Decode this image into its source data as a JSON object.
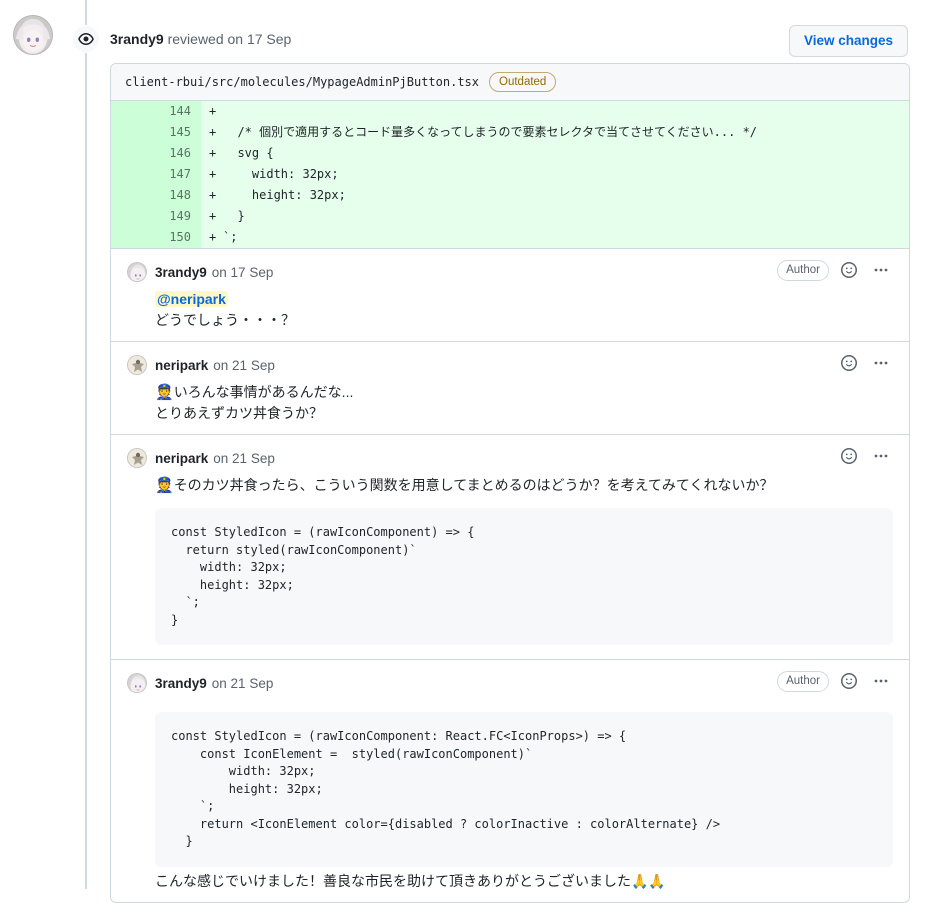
{
  "review": {
    "author": "3randy9",
    "action_text": "reviewed on 17 Sep",
    "view_changes_label": "View changes",
    "eye_icon": "eye-icon"
  },
  "diff": {
    "file_path": "client-rbui/src/molecules/MypageAdminPjButton.tsx",
    "status_badge": "Outdated",
    "lines": [
      {
        "number": "144",
        "marker": "+",
        "code": ""
      },
      {
        "number": "145",
        "marker": "+",
        "code": "  /* 個別で適用するとコード量多くなってしまうので要素セレクタで当てさせてください... */"
      },
      {
        "number": "146",
        "marker": "+",
        "code": "  svg {"
      },
      {
        "number": "147",
        "marker": "+",
        "code": "    width: 32px;"
      },
      {
        "number": "148",
        "marker": "+",
        "code": "    height: 32px;"
      },
      {
        "number": "149",
        "marker": "+",
        "code": "  }"
      },
      {
        "number": "150",
        "marker": "+",
        "code": "`;"
      }
    ]
  },
  "comments": [
    {
      "user": "3randy9",
      "date": "on 17 Sep",
      "author_badge": "Author",
      "mention": "@neripark",
      "line1": "どうでしょう・・・？"
    },
    {
      "user": "neripark",
      "date": "on 21 Sep",
      "emoji": "👮",
      "line1": "いろんな事情があるんだな...",
      "line2": "とりあえずカツ丼食うか？"
    },
    {
      "user": "neripark",
      "date": "on 21 Sep",
      "emoji": "👮",
      "line1": "そのカツ丼食ったら、こういう関数を用意してまとめるのはどうか？を考えてみてくれないか？",
      "code": "const StyledIcon = (rawIconComponent) => {\n  return styled(rawIconComponent)`\n    width: 32px;\n    height: 32px;\n  `;\n}"
    },
    {
      "user": "3randy9",
      "date": "on 21 Sep",
      "author_badge": "Author",
      "code": "const StyledIcon = (rawIconComponent: React.FC<IconProps>) => {\n    const IconElement =  styled(rawIconComponent)`\n        width: 32px;\n        height: 32px;\n    `;\n    return <IconElement color={disabled ? colorInactive : colorAlternate} />\n  }",
      "tail": "こんな感じでいけました！善良な市民を助けて頂きありがとうございました🙏🙏"
    }
  ],
  "icons": {
    "reaction": "smiley-face-icon",
    "more": "kebab-menu-icon"
  },
  "colors": {
    "accent": "#0969da",
    "diff_add_bg": "#e6ffec",
    "diff_add_gutter": "#ccffd8",
    "badge_outdated": "#9a6700",
    "border": "#d1d9e0",
    "muted_text": "#59636e",
    "code_bg": "#f6f8fa",
    "mention_bg": "#fff8c5"
  }
}
